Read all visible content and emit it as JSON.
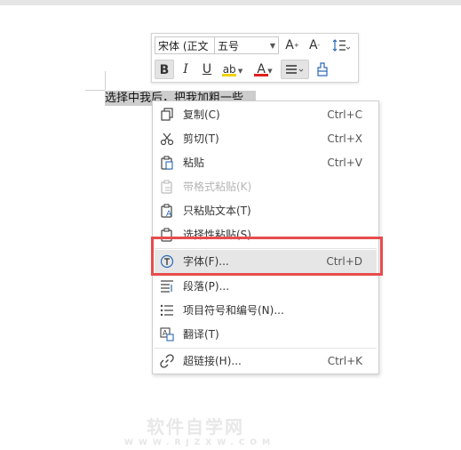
{
  "document": {
    "selected_text": "选择中我后，把我加粗一些"
  },
  "toolbar": {
    "font_name": "宋体 (正文",
    "font_size": "五号",
    "grow_font": "A",
    "shrink_font": "A",
    "bold": "B",
    "italic": "I",
    "underline": "U",
    "highlight": "ab",
    "font_color": "A",
    "highlight_color": "#f2d200",
    "font_color_value": "#e02020"
  },
  "context_menu": {
    "items": [
      {
        "label": "复制(C)",
        "shortcut": "Ctrl+C",
        "icon": "copy-icon"
      },
      {
        "label": "剪切(T)",
        "shortcut": "Ctrl+X",
        "icon": "cut-icon"
      },
      {
        "label": "粘贴",
        "shortcut": "Ctrl+V",
        "icon": "paste-icon"
      },
      {
        "label": "带格式粘贴(K)",
        "shortcut": "",
        "icon": "paste-formatted-icon",
        "disabled": true
      },
      {
        "label": "只粘贴文本(T)",
        "shortcut": "",
        "icon": "paste-text-icon"
      },
      {
        "label": "选择性粘贴(S)...",
        "shortcut": "",
        "icon": "paste-special-icon"
      },
      {
        "label": "字体(F)...",
        "shortcut": "Ctrl+D",
        "icon": "font-icon",
        "hover": true
      },
      {
        "label": "段落(P)...",
        "shortcut": "",
        "icon": "paragraph-icon"
      },
      {
        "label": "项目符号和编号(N)...",
        "shortcut": "",
        "icon": "bullets-icon"
      },
      {
        "label": "翻译(T)",
        "shortcut": "",
        "icon": "translate-icon"
      },
      {
        "label": "超链接(H)...",
        "shortcut": "Ctrl+K",
        "icon": "link-icon"
      }
    ]
  },
  "colors": {
    "highlight_box": "#e84c4c",
    "hover_row": "#e6e6e6"
  },
  "watermark": {
    "main": "软件自学网",
    "sub": "WWW.RJZXW.COM"
  }
}
